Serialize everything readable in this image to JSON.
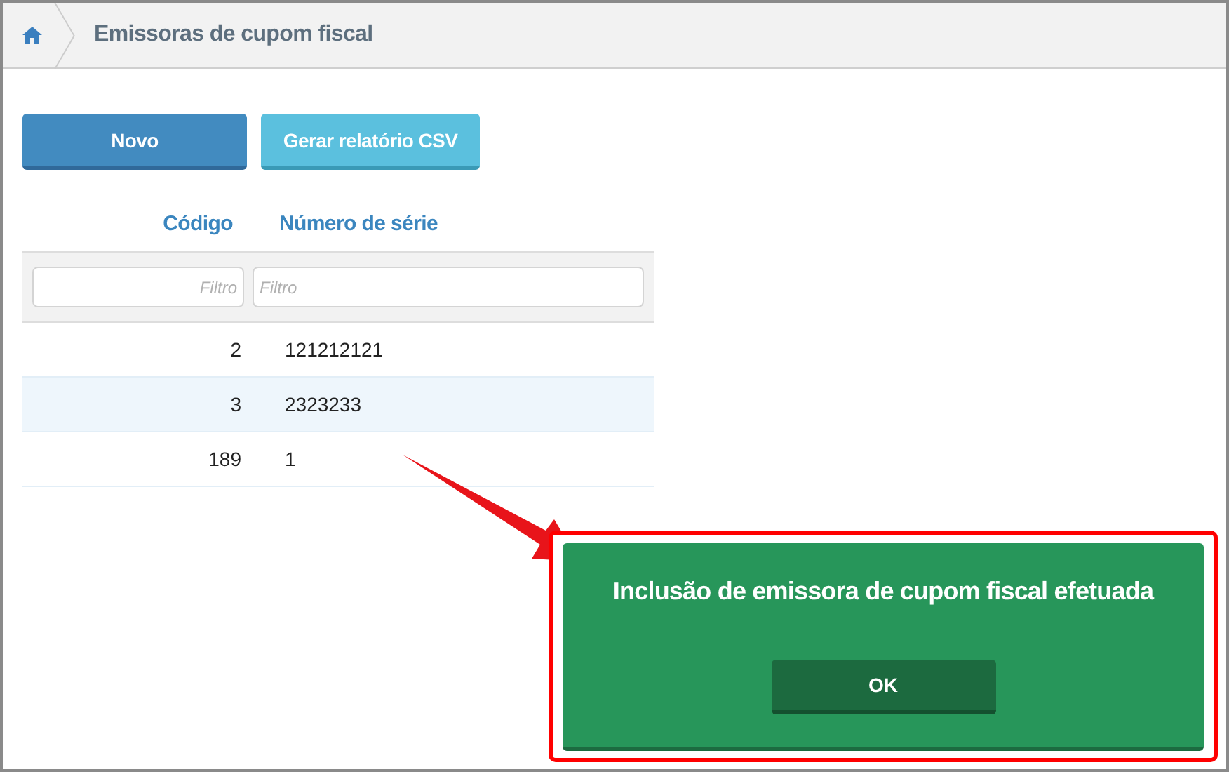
{
  "breadcrumb": {
    "title": "Emissoras de cupom fiscal"
  },
  "buttons": [
    {
      "label": "Novo",
      "kind": "primary"
    },
    {
      "label": "Gerar relatório CSV",
      "kind": "info"
    }
  ],
  "table": {
    "columns": [
      {
        "label": "Código",
        "filter_placeholder": "Filtro"
      },
      {
        "label": "Número de série",
        "filter_placeholder": "Filtro"
      }
    ],
    "rows": [
      {
        "cells": [
          "2",
          "121212121"
        ],
        "selected": false
      },
      {
        "cells": [
          "3",
          "2323233"
        ],
        "selected": true
      },
      {
        "cells": [
          "189",
          "1"
        ],
        "selected": false
      }
    ]
  },
  "dialog": {
    "message": "Inclusão de emissora de cupom fiscal efetuada",
    "button": "OK"
  }
}
